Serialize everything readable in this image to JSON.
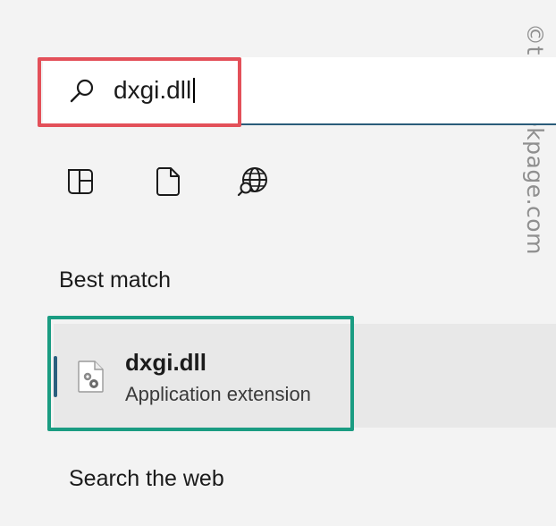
{
  "search": {
    "value": "dxgi.dll",
    "icon": "search-icon"
  },
  "filters": [
    {
      "name": "apps-filter",
      "icon": "apps-grid-icon"
    },
    {
      "name": "documents-filter",
      "icon": "document-icon"
    },
    {
      "name": "web-filter",
      "icon": "globe-search-icon"
    }
  ],
  "best_match": {
    "heading": "Best match",
    "result": {
      "title": "dxgi.dll",
      "subtitle": "Application extension",
      "icon": "dll-file-icon"
    }
  },
  "web": {
    "heading": "Search the web"
  },
  "watermark": {
    "text": "©thegeekpage.com"
  },
  "colors": {
    "background": "#f3f3f3",
    "search_underline": "#2a5c7a",
    "annotation_red": "#e35059",
    "annotation_green": "#1a9c82",
    "selection_accent": "#2a5f7e",
    "selected_row": "#e8e8e8"
  }
}
